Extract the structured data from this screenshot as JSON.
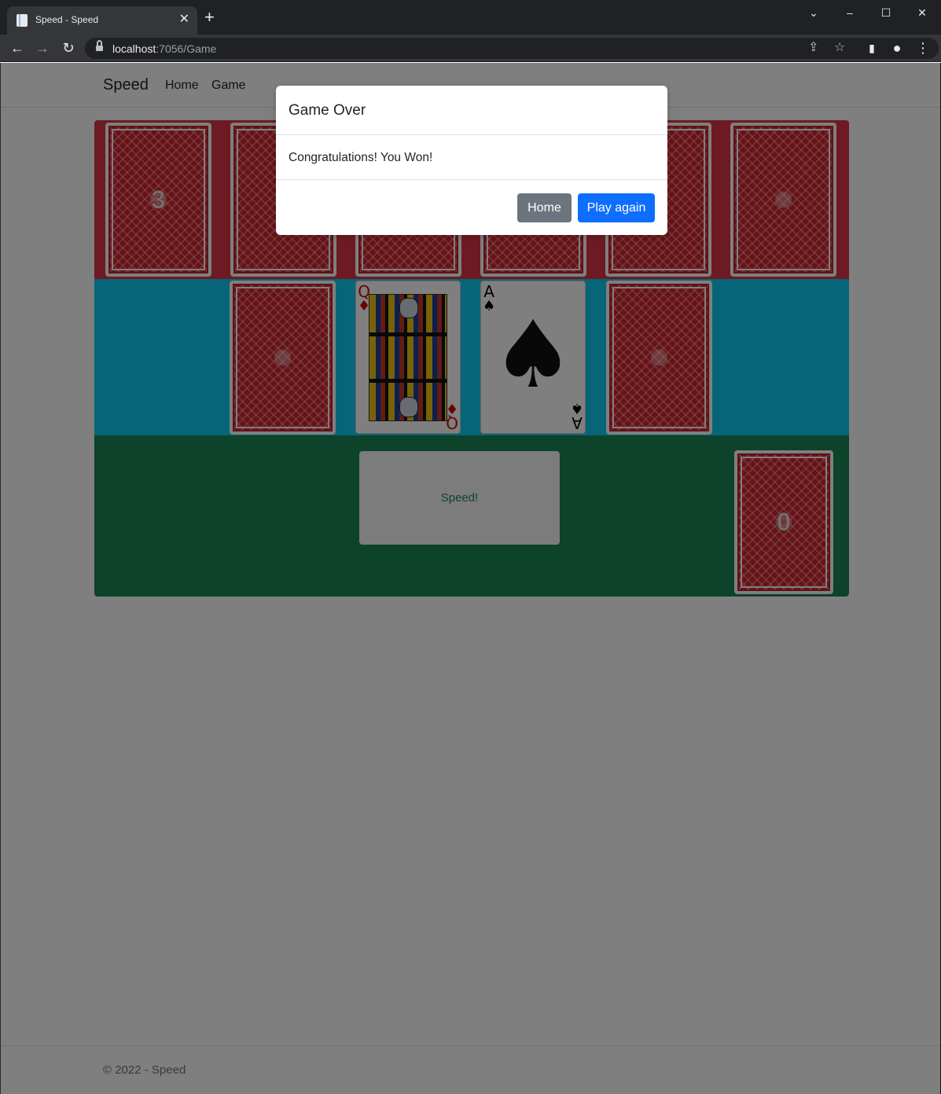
{
  "browser": {
    "tab_title": "Speed - Speed",
    "url_host": "localhost",
    "url_rest": ":7056/Game",
    "icons": [
      "back-arrow-icon",
      "forward-arrow-icon",
      "reload-icon",
      "lock-icon",
      "share-icon",
      "star-icon",
      "sidebar-icon",
      "profile-icon",
      "kebab-menu-icon"
    ]
  },
  "navbar": {
    "brand": "Speed",
    "links": [
      "Home",
      "Game"
    ]
  },
  "board": {
    "colors": {
      "opponent": "#dc3545",
      "middle": "#0dcaf0",
      "player": "#198754"
    },
    "opponent_draw_count": "3",
    "player_draw_count": "0",
    "center_cards": [
      {
        "rank": "Q",
        "suit": "♦",
        "suit_name": "diamonds"
      },
      {
        "rank": "A",
        "suit": "♠",
        "suit_name": "spades"
      }
    ],
    "speed_button": "Speed!"
  },
  "modal": {
    "title": "Game Over",
    "message": "Congratulations! You Won!",
    "home_button": "Home",
    "play_again_button": "Play again"
  },
  "footer": {
    "text": "© 2022 - Speed"
  }
}
